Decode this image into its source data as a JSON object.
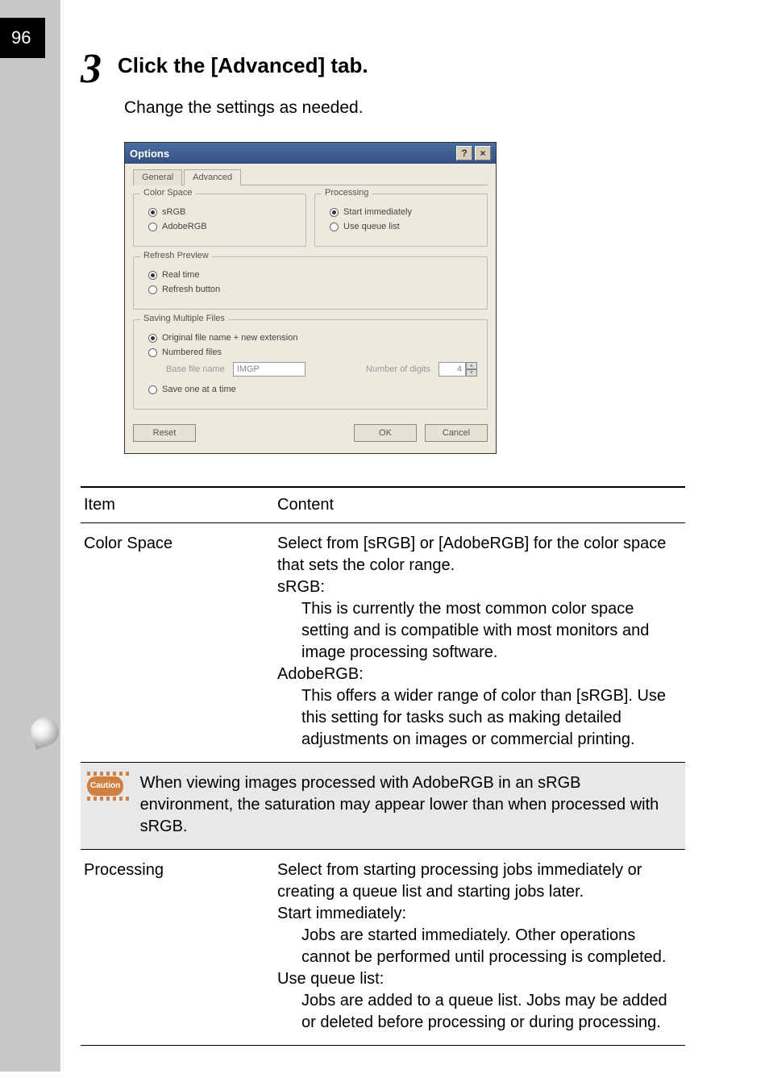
{
  "page_number": "96",
  "step": {
    "number": "3",
    "title": "Click the [Advanced] tab.",
    "subtitle": "Change the settings as needed."
  },
  "dialog": {
    "title": "Options",
    "help_glyph": "?",
    "close_glyph": "×",
    "tabs": {
      "general": "General",
      "advanced": "Advanced"
    },
    "groups": {
      "color_space": {
        "legend": "Color Space",
        "srgb": "sRGB",
        "adobergb": "AdobeRGB"
      },
      "processing": {
        "legend": "Processing",
        "start_immediately": "Start immediately",
        "use_queue": "Use queue list"
      },
      "refresh": {
        "legend": "Refresh Preview",
        "realtime": "Real time",
        "button": "Refresh button"
      },
      "saving": {
        "legend": "Saving Multiple Files",
        "original": "Original file name + new extension",
        "numbered": "Numbered files",
        "base_label": "Base file name",
        "base_value": "IMGP",
        "digits_label": "Number of digits",
        "digits_value": "4",
        "save_one": "Save one at a time"
      }
    },
    "buttons": {
      "reset": "Reset",
      "ok": "OK",
      "cancel": "Cancel"
    }
  },
  "table": {
    "headers": {
      "item": "Item",
      "content": "Content"
    },
    "rows": {
      "color_space": {
        "item": "Color Space",
        "intro": "Select from [sRGB] or [AdobeRGB] for the color space that sets the color range.",
        "srgb_h": "sRGB:",
        "srgb_d": "This is currently the most common color space setting and is compatible with most monitors and image processing software.",
        "argb_h": "AdobeRGB:",
        "argb_d": "This offers a wider range of color than [sRGB]. Use this setting for tasks such as making detailed adjustments on images or commercial printing."
      },
      "caution": {
        "label": "Caution",
        "text": "When viewing images processed with AdobeRGB in an sRGB environment, the saturation may appear lower than when processed with sRGB."
      },
      "processing": {
        "item": "Processing",
        "intro": "Select from starting processing jobs immediately or creating a queue list and starting jobs later.",
        "si_h": "Start immediately:",
        "si_d": "Jobs are started immediately. Other operations cannot be performed until processing is completed.",
        "uq_h": "Use queue list:",
        "uq_d": "Jobs are added to a queue list. Jobs may be added or deleted before processing or during processing."
      }
    }
  }
}
